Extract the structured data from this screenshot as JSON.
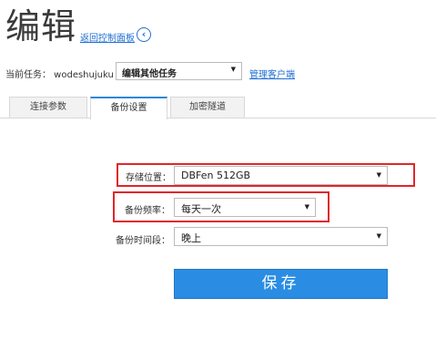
{
  "header": {
    "title": "编辑",
    "back_link": "返回控制面板",
    "back_icon": "chevron-left-circle-icon"
  },
  "task": {
    "label": "当前任务： wodeshujuku",
    "selected": "编辑其他任务",
    "manage_link": "管理客户端"
  },
  "tabs": [
    {
      "label": "连接参数",
      "active": false
    },
    {
      "label": "备份设置",
      "active": true
    },
    {
      "label": "加密隧道",
      "active": false
    }
  ],
  "form": {
    "storage": {
      "label": "存储位置：",
      "value": "DBFen 512GB"
    },
    "frequency": {
      "label": "备份频率：",
      "value": "每天一次"
    },
    "time": {
      "label": "备份时间段：",
      "value": "晚上"
    }
  },
  "save_label": "保存",
  "colors": {
    "accent": "#2a8de3",
    "link": "#1f6fd1",
    "highlight": "#e0262b"
  }
}
